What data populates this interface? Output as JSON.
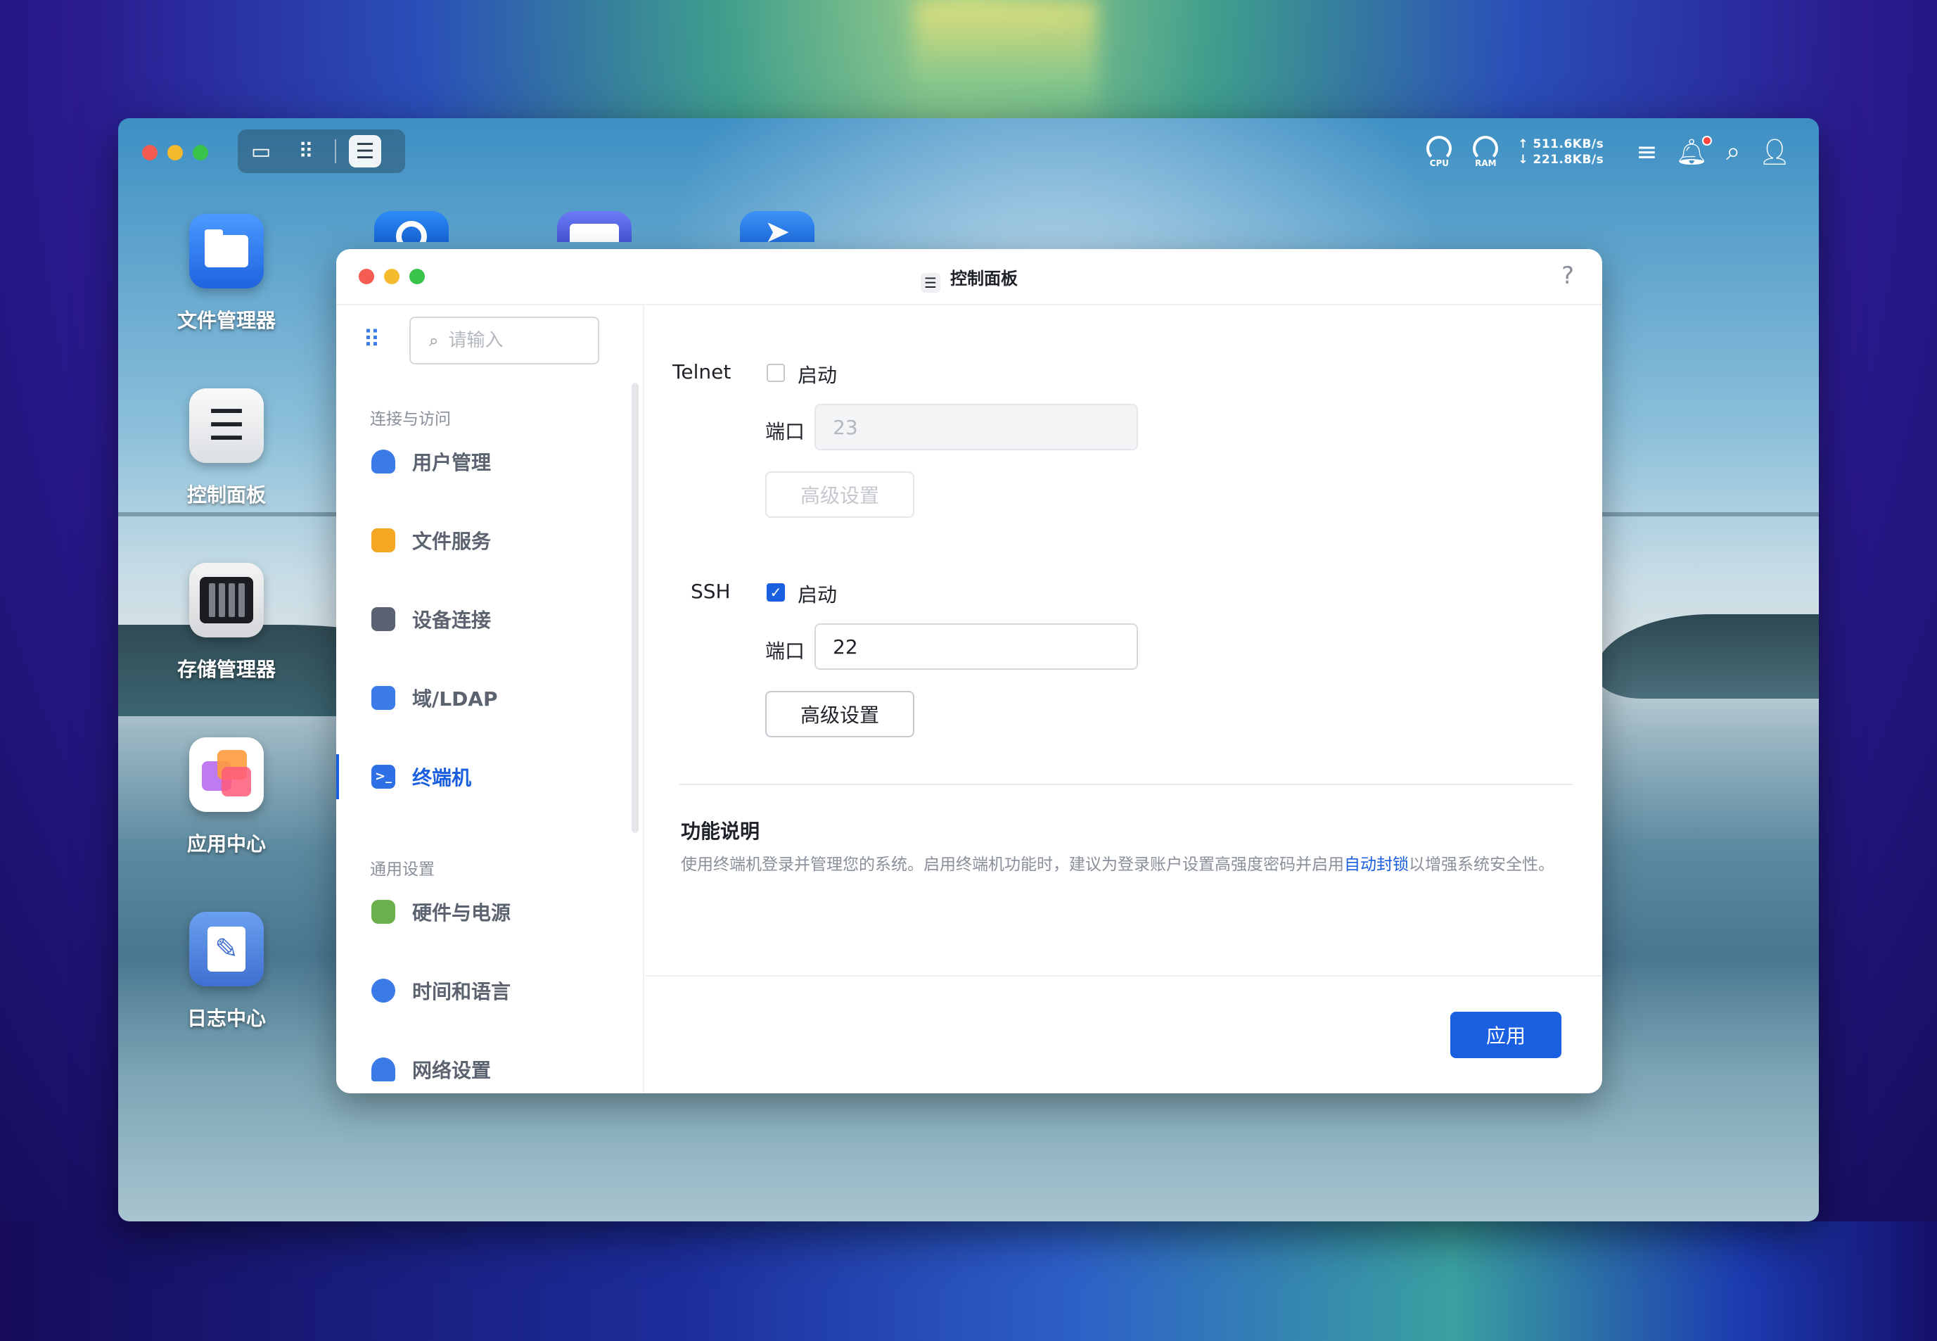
{
  "tray": {
    "cpu_label": "CPU",
    "ram_label": "RAM",
    "upload": "↑ 511.6KB/s",
    "download": "↓ 221.8KB/s"
  },
  "desktop_icons": [
    {
      "label": "文件管理器"
    },
    {
      "label": "控制面板"
    },
    {
      "label": "存储管理器"
    },
    {
      "label": "应用中心"
    },
    {
      "label": "日志中心"
    }
  ],
  "window": {
    "title": "控制面板",
    "help": "?"
  },
  "sidebar": {
    "search_placeholder": "请输入",
    "section1": "连接与访问",
    "section2": "通用设置",
    "items": [
      {
        "label": "用户管理",
        "color": "#3a7be8"
      },
      {
        "label": "文件服务",
        "color": "#f5a623"
      },
      {
        "label": "设备连接",
        "color": "#5a6274"
      },
      {
        "label": "域/LDAP",
        "color": "#3a7be8"
      },
      {
        "label": "终端机",
        "color": "#2f6fe6"
      },
      {
        "label": "硬件与电源",
        "color": "#6ab04c"
      },
      {
        "label": "时间和语言",
        "color": "#3a7be8"
      },
      {
        "label": "网络设置",
        "color": "#3a7be8"
      }
    ]
  },
  "telnet": {
    "label": "Telnet",
    "enable_label": "启动",
    "enabled": false,
    "port_label": "端口",
    "port_value": "23",
    "advanced_label": "高级设置"
  },
  "ssh": {
    "label": "SSH",
    "enable_label": "启动",
    "enabled": true,
    "port_label": "端口",
    "port_value": "22",
    "advanced_label": "高级设置"
  },
  "description": {
    "title": "功能说明",
    "text_before": "使用终端机登录并管理您的系统。启用终端机功能时，建议为登录账户设置高强度密码并启用",
    "link": "自动封锁",
    "text_after": "以增强系统安全性。"
  },
  "footer": {
    "apply_label": "应用"
  },
  "colors": {
    "accent": "#1a5fe0"
  }
}
